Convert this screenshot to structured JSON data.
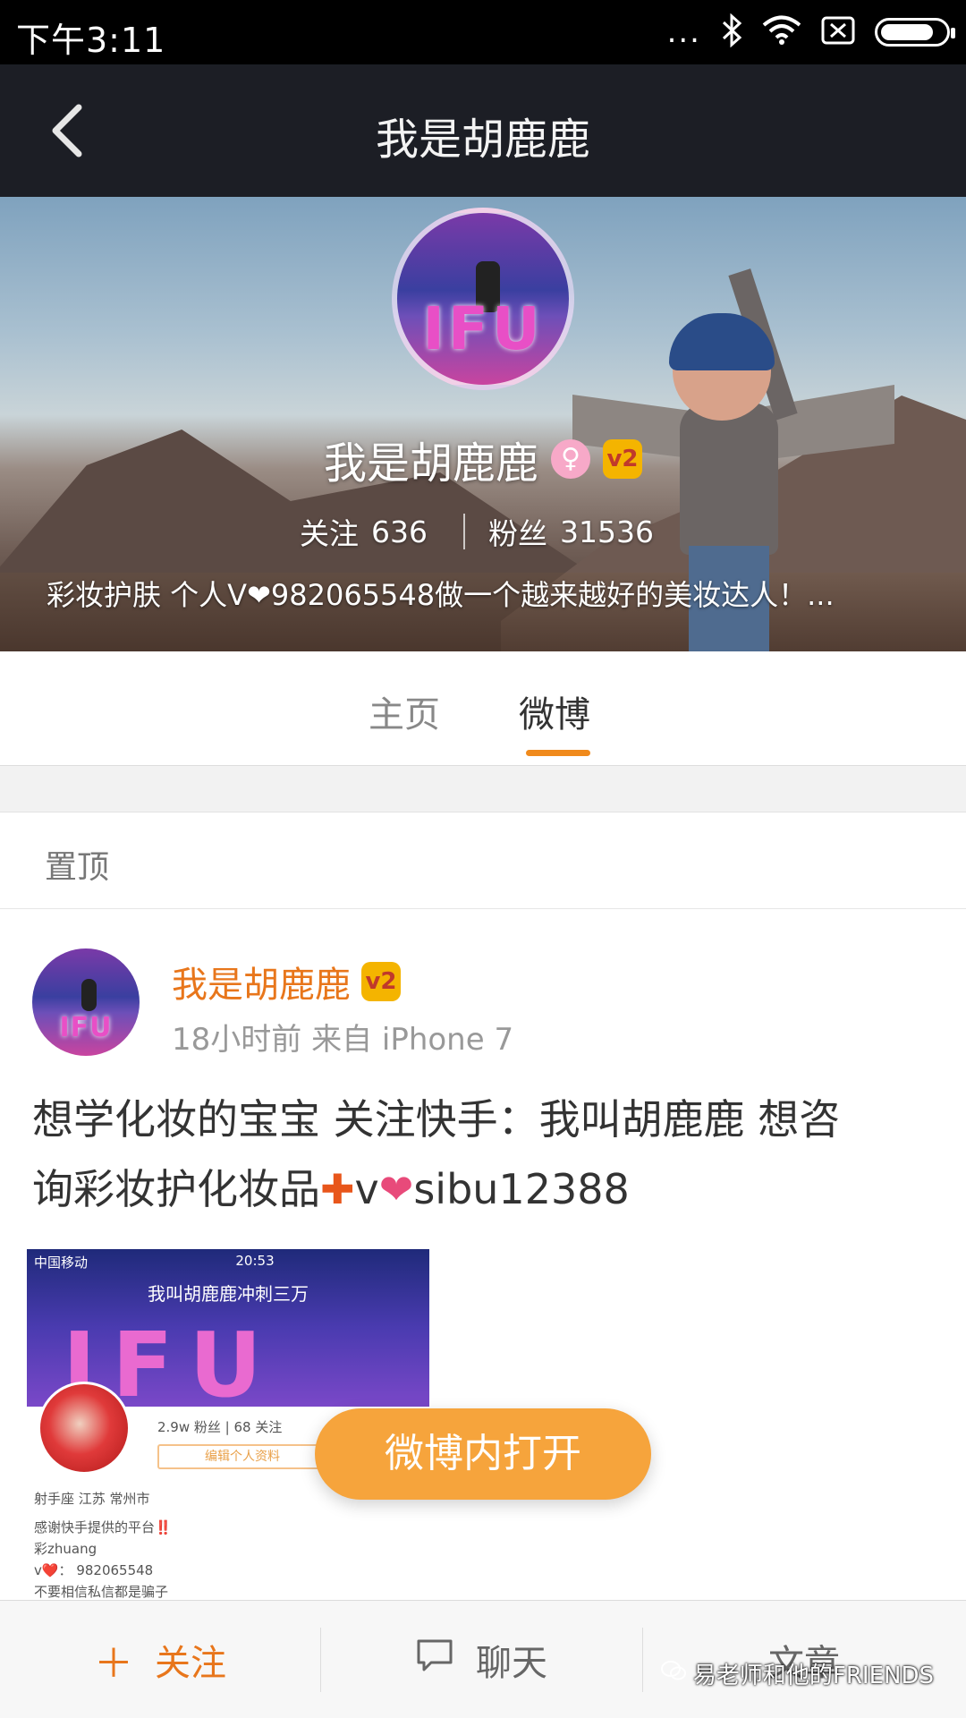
{
  "status_bar": {
    "time": "下午3:11",
    "dots": "...",
    "bluetooth_icon": "bluetooth-icon",
    "wifi_icon": "wifi-icon",
    "sim_icon": "no-sim-icon"
  },
  "header": {
    "title": "我是胡鹿鹿"
  },
  "profile": {
    "name": "我是胡鹿鹿",
    "avatar_text": "IFU",
    "female_badge": "♀",
    "vip_badge": "v2",
    "following_label": "关注",
    "following_count": "636",
    "followers_label": "粉丝",
    "followers_count": "31536",
    "bio": "彩妆护肤 个人V❤982065548做一个越来越好的美妆达人！..."
  },
  "tabs": {
    "home": "主页",
    "weibo": "微博"
  },
  "pinned_label": "置顶",
  "post": {
    "author": "我是胡鹿鹿",
    "avatar_text": "IFU",
    "meta": "18小时前 来自 iPhone 7",
    "content_line1": "想学化妆的宝宝 关注快手：我叫胡鹿鹿 想咨",
    "content_line2_a": "询彩妆护化妆品",
    "content_plus": "✚",
    "content_v": "v",
    "content_heart": "❤",
    "content_tail": "sibu12388",
    "screenshot": {
      "carrier": "中国移动",
      "time": "20:53",
      "title": "我叫胡鹿鹿冲刺三万",
      "big_text": "IFU",
      "stats": "2.9w 粉丝 | 68 关注",
      "edit_button": "编辑个人资料",
      "zodiac_loc": "射手座  江苏 常州市",
      "line1": "感谢快手提供的平台‼️",
      "line2": "彩zhuang",
      "line3": "v❤️： 982065548",
      "line4": "不要相信私信都是骗子"
    }
  },
  "open_in_weibo": "微博内打开",
  "bottom_bar": {
    "follow": "关注",
    "follow_icon": "plus-icon",
    "chat": "聊天",
    "chat_icon": "chat-bubble-icon",
    "article": "文章"
  },
  "watermark": "易老师和他的FRIENDS",
  "colors": {
    "accent": "#e8761b",
    "open_button": "#f6a43c",
    "header_bg": "#1c1e25"
  }
}
